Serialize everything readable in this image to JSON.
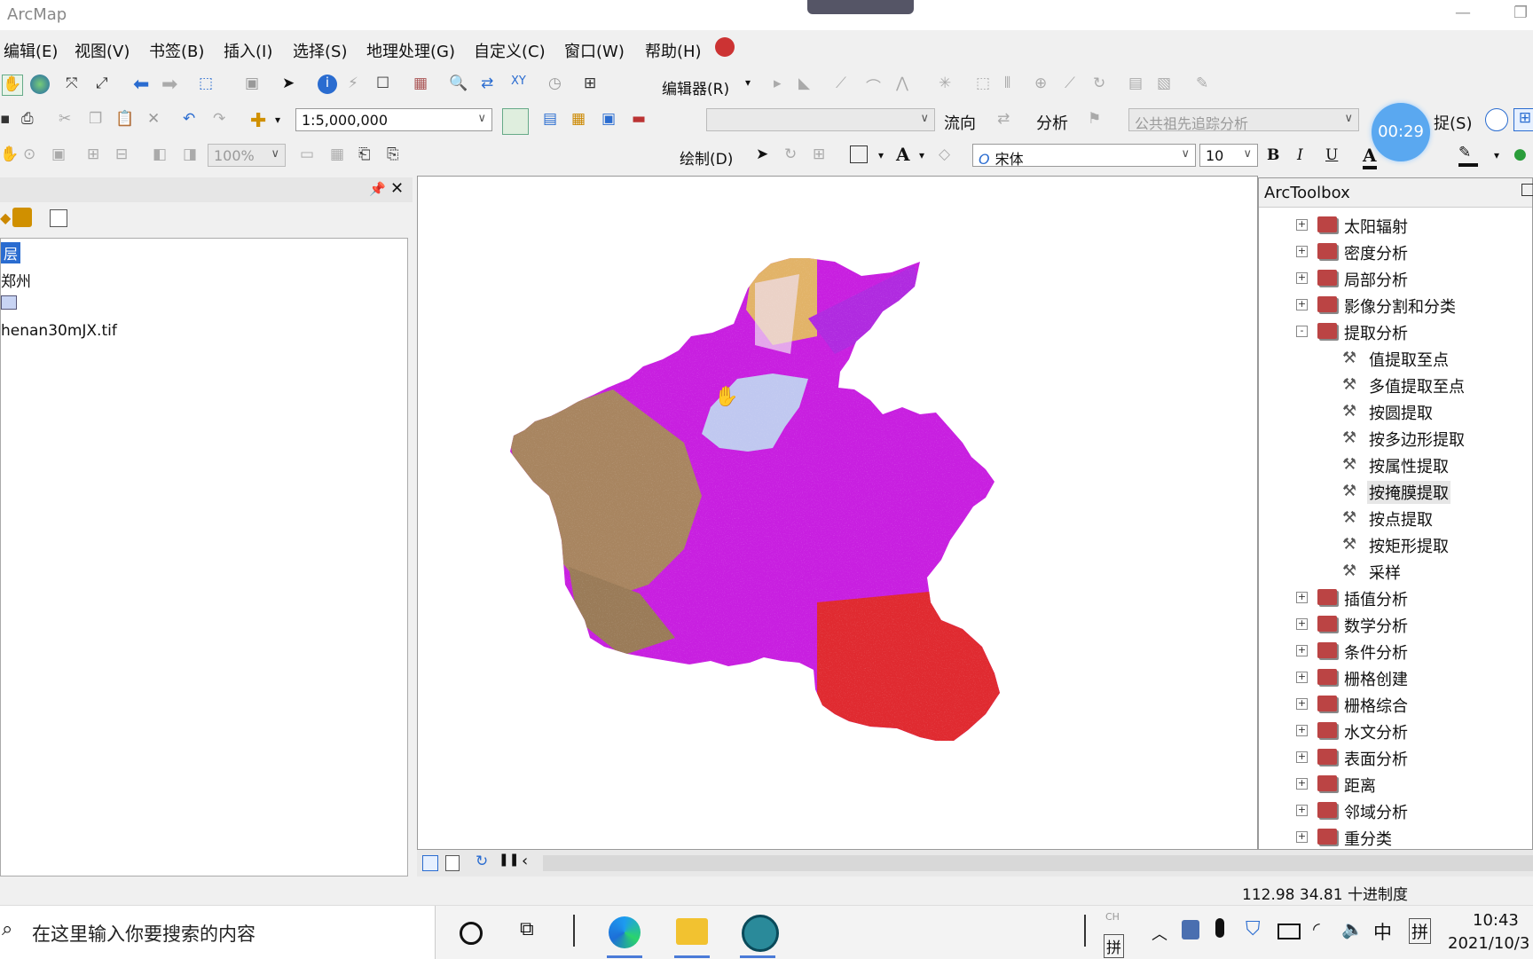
{
  "app": {
    "title": "ArcMap"
  },
  "menu": [
    "编辑(E)",
    "视图(V)",
    "书签(B)",
    "插入(I)",
    "选择(S)",
    "地理处理(G)",
    "自定义(C)",
    "窗口(W)",
    "帮助(H)"
  ],
  "toolbar": {
    "scale": "1:5,000,000",
    "editor_label": "编辑器(R)",
    "flow_label": "流向",
    "analysis_label": "分析",
    "trace_task": "公共祖先追踪分析",
    "capture_label": "捉(S)",
    "zoom": "100%",
    "draw_label": "绘制(D)",
    "font_name": "宋体",
    "font_size": "10",
    "bold": "B",
    "italic": "I",
    "underline": "U",
    "font_color": "A"
  },
  "timer": "00:29",
  "toc": {
    "layer_group": "层",
    "layer_name": "郑州",
    "raster_name": "henan30mJX.tif"
  },
  "arctoolbox": {
    "title": "ArcToolbox",
    "items": [
      {
        "label": "太阳辐射",
        "kind": "toolset",
        "state": "+"
      },
      {
        "label": "密度分析",
        "kind": "toolset",
        "state": "+"
      },
      {
        "label": "局部分析",
        "kind": "toolset",
        "state": "+"
      },
      {
        "label": "影像分割和分类",
        "kind": "toolset",
        "state": "+"
      },
      {
        "label": "提取分析",
        "kind": "toolset",
        "state": "-"
      },
      {
        "label": "值提取至点",
        "kind": "tool"
      },
      {
        "label": "多值提取至点",
        "kind": "tool"
      },
      {
        "label": "按圆提取",
        "kind": "tool"
      },
      {
        "label": "按多边形提取",
        "kind": "tool"
      },
      {
        "label": "按属性提取",
        "kind": "tool"
      },
      {
        "label": "按掩膜提取",
        "kind": "tool"
      },
      {
        "label": "按点提取",
        "kind": "tool"
      },
      {
        "label": "按矩形提取",
        "kind": "tool"
      },
      {
        "label": "采样",
        "kind": "tool"
      },
      {
        "label": "插值分析",
        "kind": "toolset",
        "state": "+"
      },
      {
        "label": "数学分析",
        "kind": "toolset",
        "state": "+"
      },
      {
        "label": "条件分析",
        "kind": "toolset",
        "state": "+"
      },
      {
        "label": "栅格创建",
        "kind": "toolset",
        "state": "+"
      },
      {
        "label": "栅格综合",
        "kind": "toolset",
        "state": "+"
      },
      {
        "label": "水文分析",
        "kind": "toolset",
        "state": "+"
      },
      {
        "label": "表面分析",
        "kind": "toolset",
        "state": "+"
      },
      {
        "label": "距离",
        "kind": "toolset",
        "state": "+"
      },
      {
        "label": "邻域分析",
        "kind": "toolset",
        "state": "+"
      },
      {
        "label": "重分类",
        "kind": "toolset",
        "state": "+"
      }
    ]
  },
  "status": {
    "coords": "112.98  34.81 十进制度"
  },
  "taskbar": {
    "search_placeholder": "在这里输入你要搜索的内容",
    "ime_top": "CH",
    "ime_bottom": "拼",
    "ime_lang": "中",
    "ime_mode": "拼",
    "time": "10:43",
    "date": "2021/10/3"
  }
}
